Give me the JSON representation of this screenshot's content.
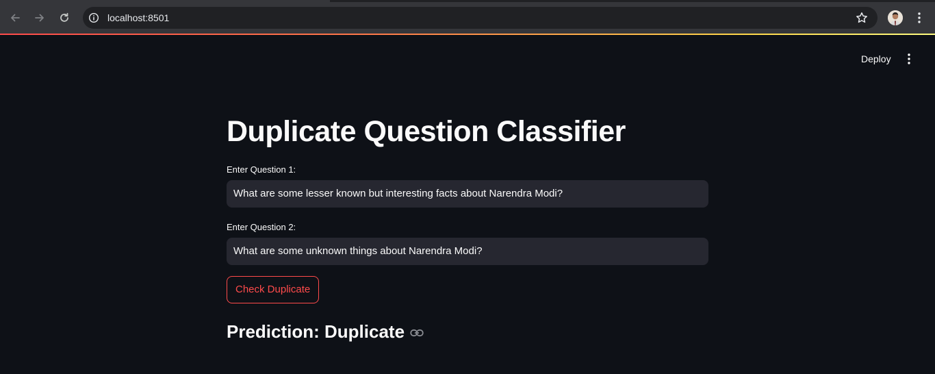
{
  "browser": {
    "url": "localhost:8501",
    "icons": {
      "back": "arrow-left-icon",
      "forward": "arrow-right-icon",
      "reload": "reload-icon",
      "site_info": "info-icon",
      "bookmark": "star-icon",
      "profile": "avatar",
      "menu": "kebab-menu-icon"
    }
  },
  "header": {
    "deploy_label": "Deploy",
    "menu_icon": "kebab-menu-icon"
  },
  "app": {
    "title": "Duplicate Question Classifier",
    "question1": {
      "label": "Enter Question 1:",
      "value": "What are some lesser known but interesting facts about Narendra Modi?"
    },
    "question2": {
      "label": "Enter Question 2:",
      "value": "What are some unknown things about Narendra Modi?"
    },
    "button_label": "Check Duplicate",
    "prediction": "Prediction: Duplicate",
    "prediction_icon": "link-icon"
  },
  "colors": {
    "background": "#0e1117",
    "input_background": "#262730",
    "accent": "#ff4b4b",
    "text": "#fafafa"
  }
}
